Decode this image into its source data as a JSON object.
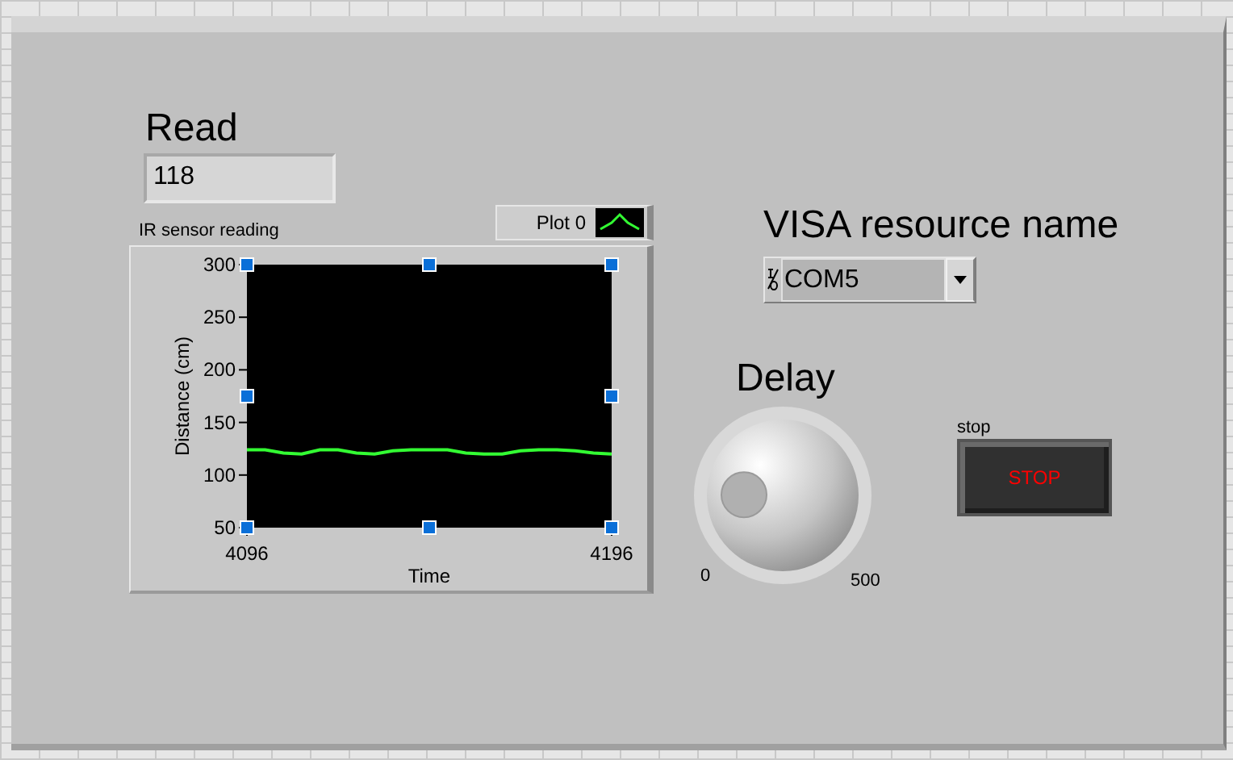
{
  "read": {
    "label": "Read",
    "value": "118"
  },
  "graph": {
    "label": "IR sensor reading",
    "chart_data": {
      "type": "line",
      "xlabel": "Time",
      "ylabel": "Distance  (cm)",
      "xlim": [
        4096,
        4196
      ],
      "ylim": [
        50,
        300
      ],
      "xticks": [
        4096,
        4196
      ],
      "yticks": [
        50,
        100,
        150,
        200,
        250,
        300
      ],
      "x": [
        4096,
        4101,
        4106,
        4111,
        4116,
        4121,
        4126,
        4131,
        4136,
        4141,
        4146,
        4151,
        4156,
        4161,
        4166,
        4171,
        4176,
        4181,
        4186,
        4191,
        4196
      ],
      "series": [
        {
          "name": "Plot 0",
          "color": "#33ff33",
          "values": [
            124,
            124,
            121,
            120,
            124,
            124,
            121,
            120,
            123,
            124,
            124,
            124,
            121,
            120,
            120,
            123,
            124,
            124,
            123,
            121,
            120
          ]
        }
      ]
    }
  },
  "visa": {
    "label": "VISA resource name",
    "value": "COM5"
  },
  "delay": {
    "label": "Delay",
    "min": "0",
    "max": "500"
  },
  "stop": {
    "label": "stop",
    "text": "STOP",
    "pressed": false
  }
}
